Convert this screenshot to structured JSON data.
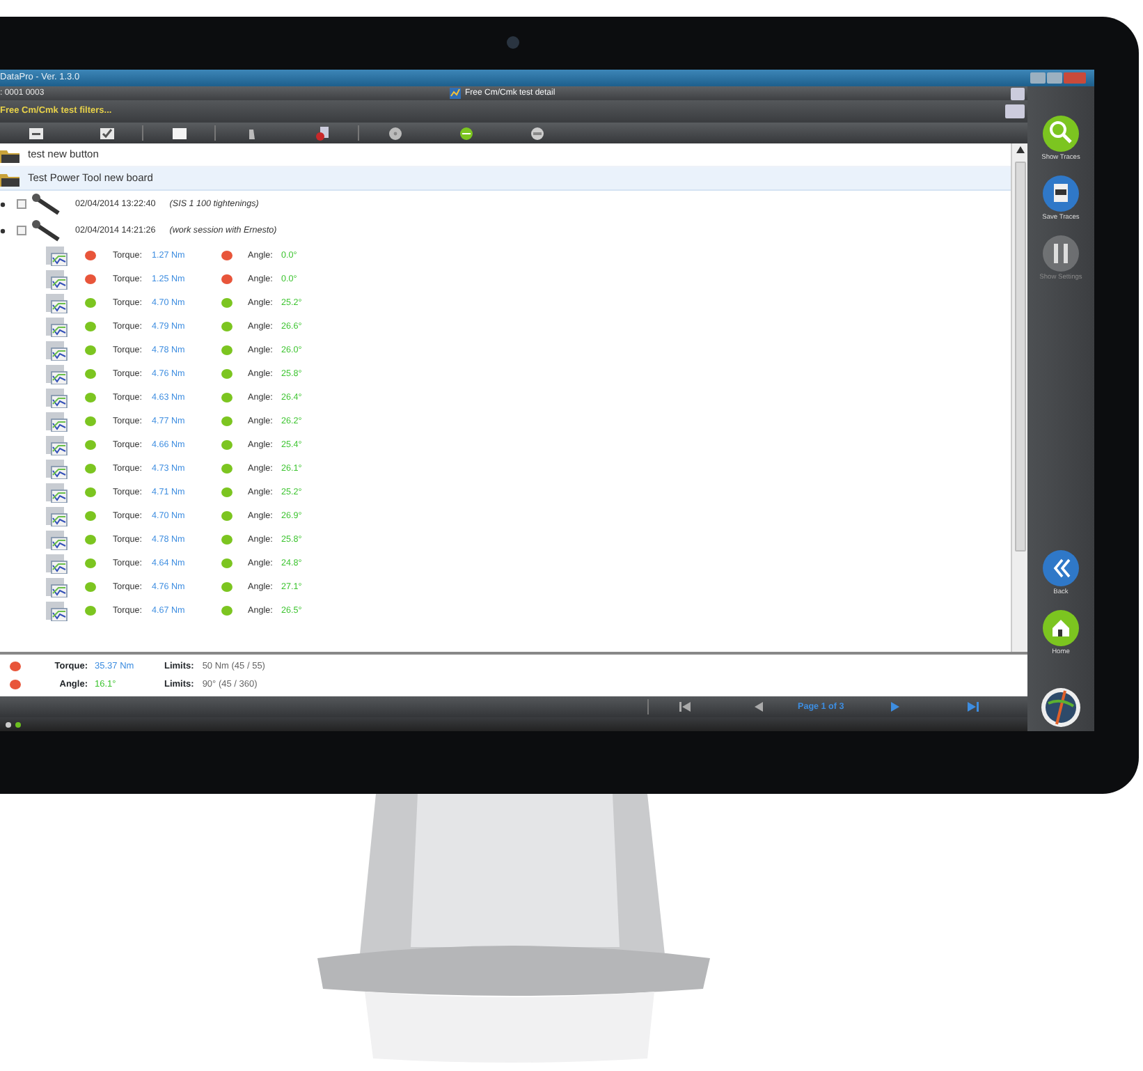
{
  "window": {
    "title": "DataPro - Ver. 1.3.0"
  },
  "header": {
    "code": ": 0001 0003",
    "detail_button": "Free Cm/Cmk test detail"
  },
  "filter": {
    "label": "Free Cm/Cmk test filters..."
  },
  "tree": [
    {
      "kind": "folder",
      "label": "test new button",
      "selected": false
    },
    {
      "kind": "folder",
      "label": "Test Power Tool new board",
      "selected": true
    },
    {
      "kind": "session",
      "date": "02/04/2014 13:22:40",
      "note": "(SIS 1 100 tightenings)",
      "checked": false
    },
    {
      "kind": "session",
      "date": "02/04/2014 14:21:26",
      "note": "(work session with Ernesto)",
      "checked": false
    }
  ],
  "measurements": [
    {
      "torque": {
        "label": "Torque:",
        "value": "1.27 Nm",
        "color": "#e8553a"
      },
      "angle": {
        "label": "Angle:",
        "value": "0.0°",
        "color": "#e8553a"
      }
    },
    {
      "torque": {
        "label": "Torque:",
        "value": "1.25 Nm",
        "color": "#e8553a"
      },
      "angle": {
        "label": "Angle:",
        "value": "0.0°",
        "color": "#e8553a"
      }
    },
    {
      "torque": {
        "label": "Torque:",
        "value": "4.70 Nm",
        "color": "#7cc520"
      },
      "angle": {
        "label": "Angle:",
        "value": "25.2°",
        "color": "#7cc520"
      }
    },
    {
      "torque": {
        "label": "Torque:",
        "value": "4.79 Nm",
        "color": "#7cc520"
      },
      "angle": {
        "label": "Angle:",
        "value": "26.6°",
        "color": "#7cc520"
      }
    },
    {
      "torque": {
        "label": "Torque:",
        "value": "4.78 Nm",
        "color": "#7cc520"
      },
      "angle": {
        "label": "Angle:",
        "value": "26.0°",
        "color": "#7cc520"
      }
    },
    {
      "torque": {
        "label": "Torque:",
        "value": "4.76 Nm",
        "color": "#7cc520"
      },
      "angle": {
        "label": "Angle:",
        "value": "25.8°",
        "color": "#7cc520"
      }
    },
    {
      "torque": {
        "label": "Torque:",
        "value": "4.63 Nm",
        "color": "#7cc520"
      },
      "angle": {
        "label": "Angle:",
        "value": "26.4°",
        "color": "#7cc520"
      }
    },
    {
      "torque": {
        "label": "Torque:",
        "value": "4.77 Nm",
        "color": "#7cc520"
      },
      "angle": {
        "label": "Angle:",
        "value": "26.2°",
        "color": "#7cc520"
      }
    },
    {
      "torque": {
        "label": "Torque:",
        "value": "4.66 Nm",
        "color": "#7cc520"
      },
      "angle": {
        "label": "Angle:",
        "value": "25.4°",
        "color": "#7cc520"
      }
    },
    {
      "torque": {
        "label": "Torque:",
        "value": "4.73 Nm",
        "color": "#7cc520"
      },
      "angle": {
        "label": "Angle:",
        "value": "26.1°",
        "color": "#7cc520"
      }
    },
    {
      "torque": {
        "label": "Torque:",
        "value": "4.71 Nm",
        "color": "#7cc520"
      },
      "angle": {
        "label": "Angle:",
        "value": "25.2°",
        "color": "#7cc520"
      }
    },
    {
      "torque": {
        "label": "Torque:",
        "value": "4.70 Nm",
        "color": "#7cc520"
      },
      "angle": {
        "label": "Angle:",
        "value": "26.9°",
        "color": "#7cc520"
      }
    },
    {
      "torque": {
        "label": "Torque:",
        "value": "4.78 Nm",
        "color": "#7cc520"
      },
      "angle": {
        "label": "Angle:",
        "value": "25.8°",
        "color": "#7cc520"
      }
    },
    {
      "torque": {
        "label": "Torque:",
        "value": "4.64 Nm",
        "color": "#7cc520"
      },
      "angle": {
        "label": "Angle:",
        "value": "24.8°",
        "color": "#7cc520"
      }
    },
    {
      "torque": {
        "label": "Torque:",
        "value": "4.76 Nm",
        "color": "#7cc520"
      },
      "angle": {
        "label": "Angle:",
        "value": "27.1°",
        "color": "#7cc520"
      }
    },
    {
      "torque": {
        "label": "Torque:",
        "value": "4.67 Nm",
        "color": "#7cc520"
      },
      "angle": {
        "label": "Angle:",
        "value": "26.5°",
        "color": "#7cc520"
      }
    }
  ],
  "summary": [
    {
      "label": "Torque:",
      "value": "35.37 Nm",
      "kind": "torque",
      "limits_label": "Limits:",
      "limits": "50 Nm (45 / 55)",
      "color": "#e8553a"
    },
    {
      "label": "Angle:",
      "value": "16.1°",
      "kind": "angle",
      "limits_label": "Limits:",
      "limits": "90° (45 / 360)",
      "color": "#e8553a"
    }
  ],
  "pager": {
    "text": "Page 1 of 3"
  },
  "side_buttons": [
    {
      "kind": "search",
      "label": "Show Traces",
      "disabled": false
    },
    {
      "kind": "save",
      "label": "Save Traces",
      "disabled": false
    },
    {
      "kind": "settings",
      "label": "Show Settings",
      "disabled": true
    },
    {
      "kind": "back",
      "label": "Back",
      "disabled": false
    },
    {
      "kind": "home",
      "label": "Home",
      "disabled": false
    }
  ]
}
